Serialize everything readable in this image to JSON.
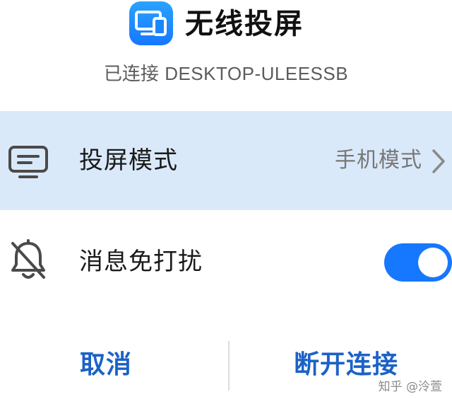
{
  "header": {
    "app_title": "无线投屏",
    "status_prefix": "已连接",
    "device_name": "DESKTOP-ULEESSB"
  },
  "projection_mode": {
    "label": "投屏模式",
    "value": "手机模式",
    "icon": "monitor-icon",
    "chevron_icon": "chevron-right-icon"
  },
  "do_not_disturb": {
    "label": "消息免打扰",
    "icon": "bell-off-icon",
    "enabled": true
  },
  "footer": {
    "cancel_label": "取消",
    "disconnect_label": "断开连接"
  },
  "watermark": "知乎 @泠萱",
  "colors": {
    "accent": "#1677ff",
    "button_text": "#1b62c7",
    "highlight_row": "#dae9fa"
  }
}
